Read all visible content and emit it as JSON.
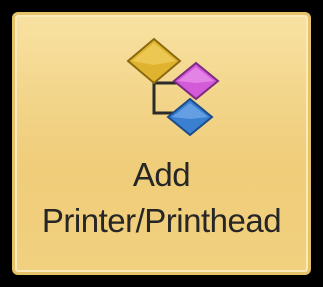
{
  "button": {
    "label_line1": "Add",
    "label_line2": "Printer/Printhead",
    "icon": "add-printer-hierarchy-icon"
  },
  "colors": {
    "background": "#000000",
    "button_fill": "#f3d68c",
    "button_border": "#e6c36b",
    "text": "#262626",
    "node_yellow": "#e0b32e",
    "node_magenta": "#d35ad8",
    "node_blue": "#3b7fd0"
  }
}
